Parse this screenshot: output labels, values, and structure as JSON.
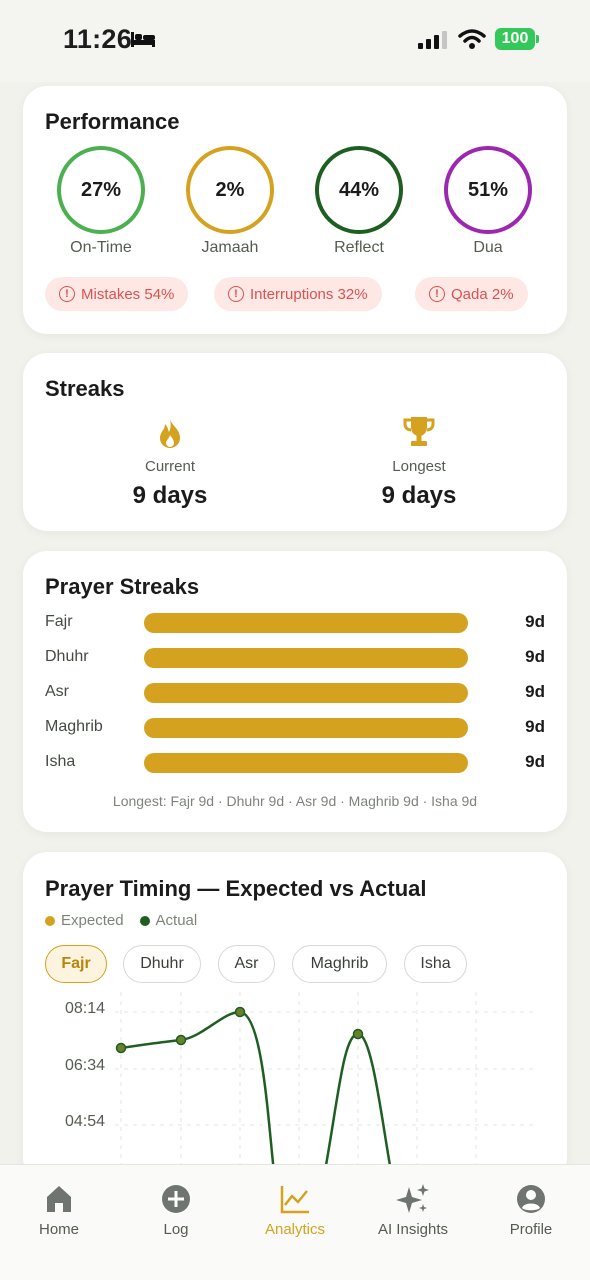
{
  "status": {
    "time": "11:26",
    "battery": "100"
  },
  "performance": {
    "title": "Performance",
    "rings": [
      {
        "value": "27%",
        "label": "On-Time",
        "color": "#4caf50"
      },
      {
        "value": "2%",
        "label": "Jamaah",
        "color": "#d4a21f"
      },
      {
        "value": "44%",
        "label": "Reflect",
        "color": "#1e5e20"
      },
      {
        "value": "51%",
        "label": "Dua",
        "color": "#9c27b0"
      }
    ],
    "pills": [
      {
        "label": "Mistakes 54%"
      },
      {
        "label": "Interruptions 32%"
      },
      {
        "label": "Qada 2%"
      }
    ]
  },
  "streaks": {
    "title": "Streaks",
    "current_label": "Current",
    "current_value": "9 days",
    "longest_label": "Longest",
    "longest_value": "9 days"
  },
  "prayer_streaks": {
    "title": "Prayer Streaks",
    "rows": [
      {
        "name": "Fajr",
        "value": "9d",
        "fill": 1.0
      },
      {
        "name": "Dhuhr",
        "value": "9d",
        "fill": 1.0
      },
      {
        "name": "Asr",
        "value": "9d",
        "fill": 1.0
      },
      {
        "name": "Maghrib",
        "value": "9d",
        "fill": 1.0
      },
      {
        "name": "Isha",
        "value": "9d",
        "fill": 1.0
      }
    ],
    "footer": "Longest: Fajr 9d · Dhuhr 9d · Asr 9d · Maghrib 9d · Isha 9d"
  },
  "timing": {
    "title": "Prayer Timing — Expected vs Actual",
    "legend_expected": "Expected",
    "legend_actual": "Actual",
    "expected_color": "#d4a21f",
    "actual_color": "#1e5e20",
    "tabs": [
      "Fajr",
      "Dhuhr",
      "Asr",
      "Maghrib",
      "Isha"
    ],
    "active_tab": "Fajr"
  },
  "chart_data": {
    "type": "line",
    "title": "Prayer Timing — Expected vs Actual",
    "yticks": [
      "08:14",
      "06:34",
      "04:54"
    ],
    "series": [
      {
        "name": "Actual",
        "values_minutes": [
          430,
          450,
          500,
          null,
          null,
          480,
          null
        ]
      }
    ]
  },
  "tabbar": {
    "items": [
      {
        "label": "Home",
        "icon": "home-icon"
      },
      {
        "label": "Log",
        "icon": "plus-circle-icon"
      },
      {
        "label": "Analytics",
        "icon": "chart-icon"
      },
      {
        "label": "AI Insights",
        "icon": "sparkles-icon"
      },
      {
        "label": "Profile",
        "icon": "person-circle-icon"
      }
    ],
    "active": "Analytics"
  }
}
